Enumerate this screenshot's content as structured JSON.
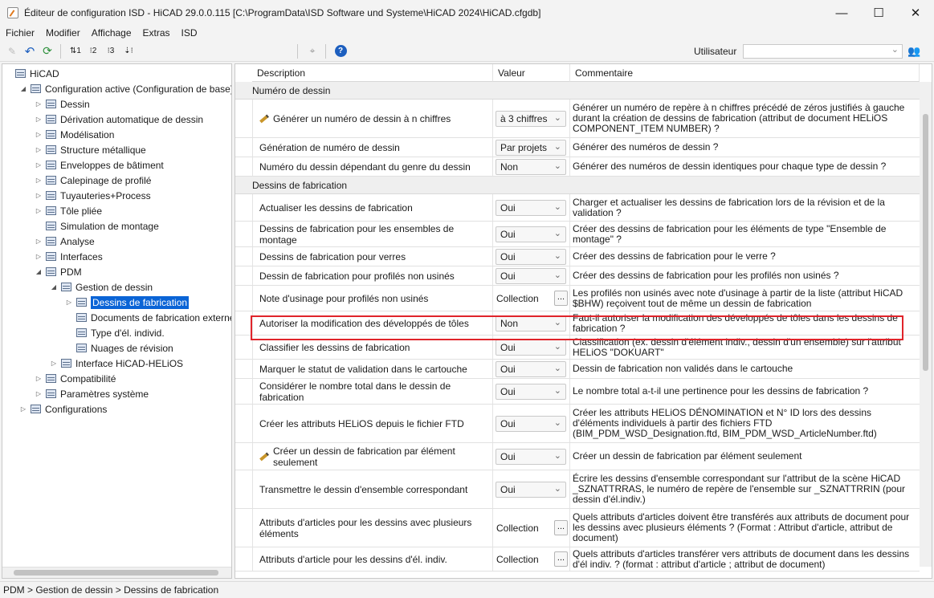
{
  "window": {
    "title": "Éditeur de configuration ISD  -  HiCAD 29.0.0.115 [C:\\ProgramData\\ISD Software und Systeme\\HiCAD 2024\\HiCAD.cfgdb]",
    "minimize": "—",
    "maximize": "☐",
    "close": "✕"
  },
  "menu": [
    "Fichier",
    "Modifier",
    "Affichage",
    "Extras",
    "ISD"
  ],
  "toolbar": {
    "user_label": "Utilisateur",
    "user_value": "",
    "icons": [
      "pencil-icon",
      "undo-icon",
      "refresh-icon",
      "sort-numeric-icon",
      "level-2-icon",
      "level-3-icon",
      "expand-icon",
      "binoculars-icon",
      "help-icon"
    ]
  },
  "tree": [
    {
      "label": "HiCAD",
      "level": 0,
      "expander": ""
    },
    {
      "label": "Configuration active (Configuration de base)",
      "level": 1,
      "expander": "◢"
    },
    {
      "label": "Dessin",
      "level": 2,
      "expander": "▷"
    },
    {
      "label": "Dérivation automatique de dessin",
      "level": 2,
      "expander": "▷"
    },
    {
      "label": "Modélisation",
      "level": 2,
      "expander": "▷"
    },
    {
      "label": "Structure métallique",
      "level": 2,
      "expander": "▷"
    },
    {
      "label": "Enveloppes de bâtiment",
      "level": 2,
      "expander": "▷"
    },
    {
      "label": "Calepinage de profilé",
      "level": 2,
      "expander": "▷"
    },
    {
      "label": "Tuyauteries+Process",
      "level": 2,
      "expander": "▷"
    },
    {
      "label": "Tôle pliée",
      "level": 2,
      "expander": "▷"
    },
    {
      "label": "Simulation de montage",
      "level": 2,
      "expander": ""
    },
    {
      "label": "Analyse",
      "level": 2,
      "expander": "▷"
    },
    {
      "label": "Interfaces",
      "level": 2,
      "expander": "▷"
    },
    {
      "label": "PDM",
      "level": 2,
      "expander": "◢"
    },
    {
      "label": "Gestion de dessin",
      "level": 3,
      "expander": "◢"
    },
    {
      "label": "Dessins de fabrication",
      "level": 4,
      "expander": "▷",
      "selected": true
    },
    {
      "label": "Documents de fabrication externes",
      "level": 4,
      "expander": ""
    },
    {
      "label": "Type d'él. individ.",
      "level": 4,
      "expander": ""
    },
    {
      "label": "Nuages de révision",
      "level": 4,
      "expander": ""
    },
    {
      "label": "Interface HiCAD-HELiOS",
      "level": 3,
      "expander": "▷"
    },
    {
      "label": "Compatibilité",
      "level": 2,
      "expander": "▷"
    },
    {
      "label": "Paramètres système",
      "level": 2,
      "expander": "▷"
    },
    {
      "label": "Configurations",
      "level": 1,
      "expander": "▷"
    }
  ],
  "grid": {
    "headers": [
      "Description",
      "Valeur",
      "Commentaire"
    ],
    "categories": [
      "Numéro de dessin",
      "Dessins de fabrication"
    ],
    "rows": [
      {
        "desc": "Générer un numéro de dessin à n chiffres",
        "value": "à 3 chiffres",
        "kind": "select",
        "edited": true,
        "comment": "Générer un numéro de repère à n chiffres précédé de zéros justifiés à gauche durant la création de dessins de fabrication (attribut de document HELiOS COMPONENT_ITEM NUMBER) ?"
      },
      {
        "desc": "Génération de numéro de dessin",
        "value": "Par projets",
        "kind": "select",
        "comment": "Générer des numéros de dessin ?"
      },
      {
        "desc": "Numéro du dessin dépendant du genre du dessin",
        "value": "Non",
        "kind": "select",
        "comment": "Générer des numéros de dessin identiques pour chaque type de dessin ?"
      },
      {
        "desc": "Actualiser les dessins de fabrication",
        "value": "Oui",
        "kind": "select",
        "comment": "Charger et actualiser les dessins de fabrication lors de la révision et de la validation ?"
      },
      {
        "desc": "Dessins de fabrication pour les ensembles de montage",
        "value": "Oui",
        "kind": "select",
        "comment": "Créer des dessins de fabrication pour les éléments de type \"Ensemble de montage\" ?"
      },
      {
        "desc": "Dessins de fabrication pour verres",
        "value": "Oui",
        "kind": "select",
        "comment": "Créer des dessins de fabrication pour le verre ?"
      },
      {
        "desc": "Dessin de fabrication pour profilés non usinés",
        "value": "Oui",
        "kind": "select",
        "comment": "Créer des dessins de fabrication pour les profilés non usinés ?"
      },
      {
        "desc": "Note d'usinage pour profilés non usinés",
        "value": "Collection",
        "kind": "collection",
        "comment": "Les profilés non usinés avec note d'usinage à partir de la liste (attribut HiCAD $BHW) reçoivent tout de même un dessin de fabrication"
      },
      {
        "desc": "Autoriser la modification des développés de tôles",
        "value": "Non",
        "kind": "select",
        "comment": "Faut-il autoriser la modification des développés de tôles dans les dessins de fabrication ?"
      },
      {
        "desc": "Classifier les dessins de fabrication",
        "value": "Oui",
        "kind": "select",
        "comment": "Classification (ex. dessin d'élément indiv., dessin d'un ensemble) sur l'attribut HELiOS \"DOKUART\""
      },
      {
        "desc": "Marquer le statut de validation dans le cartouche",
        "value": "Oui",
        "kind": "select",
        "comment": "Dessin de fabrication non validés dans le cartouche"
      },
      {
        "desc": "Considérer le nombre total dans le dessin de fabrication",
        "value": "Oui",
        "kind": "select",
        "comment": "Le nombre total a-t-il une pertinence pour les dessins de fabrication ?"
      },
      {
        "desc": "Créer les attributs HELiOS depuis le fichier FTD",
        "value": "Oui",
        "kind": "select",
        "comment": "Créer les attributs HELiOS DÉNOMINATION et N° ID lors des dessins d'éléments individuels à partir des fichiers FTD (BIM_PDM_WSD_Designation.ftd, BIM_PDM_WSD_ArticleNumber.ftd)"
      },
      {
        "desc": "Créer un dessin de fabrication par élément seulement",
        "value": "Oui",
        "kind": "select",
        "edited": true,
        "comment": "Créer un dessin de fabrication par élément seulement"
      },
      {
        "desc": "Transmettre le dessin d'ensemble correspondant",
        "value": "Oui",
        "kind": "select",
        "comment": "Écrire les dessins d'ensemble correspondant sur l'attribut de la scène HiCAD _SZNATTRRAS, le numéro de repère de l'ensemble sur _SZNATTRRIN (pour dessin d'él.indiv.)"
      },
      {
        "desc": "Attributs d'articles pour les dessins avec plusieurs éléments",
        "value": "Collection",
        "kind": "collection",
        "comment": "Quels attributs d'articles doivent être transférés aux attributs de document pour les dessins avec plusieurs éléments ? (Format : Attribut d'article, attribut de document)"
      },
      {
        "desc": "Attributs d'article pour les dessins d'él. indiv.",
        "value": "Collection",
        "kind": "collection",
        "comment": "Quels attributs d'articles transférer vers attributs de document dans les dessins d'él indiv. ? (format : attribut d'article ; attribut de document)"
      }
    ]
  },
  "status": "PDM > Gestion de dessin > Dessins de fabrication"
}
